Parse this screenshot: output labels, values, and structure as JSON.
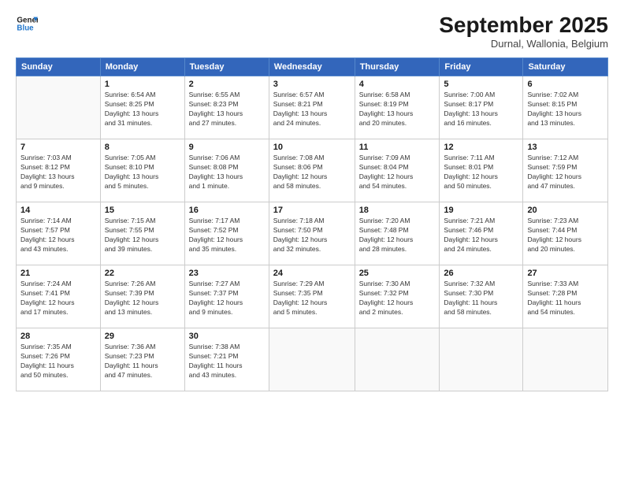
{
  "logo": {
    "line1": "General",
    "line2": "Blue"
  },
  "header": {
    "month_year": "September 2025",
    "location": "Durnal, Wallonia, Belgium"
  },
  "days_of_week": [
    "Sunday",
    "Monday",
    "Tuesday",
    "Wednesday",
    "Thursday",
    "Friday",
    "Saturday"
  ],
  "weeks": [
    [
      {
        "day": "",
        "info": ""
      },
      {
        "day": "1",
        "info": "Sunrise: 6:54 AM\nSunset: 8:25 PM\nDaylight: 13 hours\nand 31 minutes."
      },
      {
        "day": "2",
        "info": "Sunrise: 6:55 AM\nSunset: 8:23 PM\nDaylight: 13 hours\nand 27 minutes."
      },
      {
        "day": "3",
        "info": "Sunrise: 6:57 AM\nSunset: 8:21 PM\nDaylight: 13 hours\nand 24 minutes."
      },
      {
        "day": "4",
        "info": "Sunrise: 6:58 AM\nSunset: 8:19 PM\nDaylight: 13 hours\nand 20 minutes."
      },
      {
        "day": "5",
        "info": "Sunrise: 7:00 AM\nSunset: 8:17 PM\nDaylight: 13 hours\nand 16 minutes."
      },
      {
        "day": "6",
        "info": "Sunrise: 7:02 AM\nSunset: 8:15 PM\nDaylight: 13 hours\nand 13 minutes."
      }
    ],
    [
      {
        "day": "7",
        "info": "Sunrise: 7:03 AM\nSunset: 8:12 PM\nDaylight: 13 hours\nand 9 minutes."
      },
      {
        "day": "8",
        "info": "Sunrise: 7:05 AM\nSunset: 8:10 PM\nDaylight: 13 hours\nand 5 minutes."
      },
      {
        "day": "9",
        "info": "Sunrise: 7:06 AM\nSunset: 8:08 PM\nDaylight: 13 hours\nand 1 minute."
      },
      {
        "day": "10",
        "info": "Sunrise: 7:08 AM\nSunset: 8:06 PM\nDaylight: 12 hours\nand 58 minutes."
      },
      {
        "day": "11",
        "info": "Sunrise: 7:09 AM\nSunset: 8:04 PM\nDaylight: 12 hours\nand 54 minutes."
      },
      {
        "day": "12",
        "info": "Sunrise: 7:11 AM\nSunset: 8:01 PM\nDaylight: 12 hours\nand 50 minutes."
      },
      {
        "day": "13",
        "info": "Sunrise: 7:12 AM\nSunset: 7:59 PM\nDaylight: 12 hours\nand 47 minutes."
      }
    ],
    [
      {
        "day": "14",
        "info": "Sunrise: 7:14 AM\nSunset: 7:57 PM\nDaylight: 12 hours\nand 43 minutes."
      },
      {
        "day": "15",
        "info": "Sunrise: 7:15 AM\nSunset: 7:55 PM\nDaylight: 12 hours\nand 39 minutes."
      },
      {
        "day": "16",
        "info": "Sunrise: 7:17 AM\nSunset: 7:52 PM\nDaylight: 12 hours\nand 35 minutes."
      },
      {
        "day": "17",
        "info": "Sunrise: 7:18 AM\nSunset: 7:50 PM\nDaylight: 12 hours\nand 32 minutes."
      },
      {
        "day": "18",
        "info": "Sunrise: 7:20 AM\nSunset: 7:48 PM\nDaylight: 12 hours\nand 28 minutes."
      },
      {
        "day": "19",
        "info": "Sunrise: 7:21 AM\nSunset: 7:46 PM\nDaylight: 12 hours\nand 24 minutes."
      },
      {
        "day": "20",
        "info": "Sunrise: 7:23 AM\nSunset: 7:44 PM\nDaylight: 12 hours\nand 20 minutes."
      }
    ],
    [
      {
        "day": "21",
        "info": "Sunrise: 7:24 AM\nSunset: 7:41 PM\nDaylight: 12 hours\nand 17 minutes."
      },
      {
        "day": "22",
        "info": "Sunrise: 7:26 AM\nSunset: 7:39 PM\nDaylight: 12 hours\nand 13 minutes."
      },
      {
        "day": "23",
        "info": "Sunrise: 7:27 AM\nSunset: 7:37 PM\nDaylight: 12 hours\nand 9 minutes."
      },
      {
        "day": "24",
        "info": "Sunrise: 7:29 AM\nSunset: 7:35 PM\nDaylight: 12 hours\nand 5 minutes."
      },
      {
        "day": "25",
        "info": "Sunrise: 7:30 AM\nSunset: 7:32 PM\nDaylight: 12 hours\nand 2 minutes."
      },
      {
        "day": "26",
        "info": "Sunrise: 7:32 AM\nSunset: 7:30 PM\nDaylight: 11 hours\nand 58 minutes."
      },
      {
        "day": "27",
        "info": "Sunrise: 7:33 AM\nSunset: 7:28 PM\nDaylight: 11 hours\nand 54 minutes."
      }
    ],
    [
      {
        "day": "28",
        "info": "Sunrise: 7:35 AM\nSunset: 7:26 PM\nDaylight: 11 hours\nand 50 minutes."
      },
      {
        "day": "29",
        "info": "Sunrise: 7:36 AM\nSunset: 7:23 PM\nDaylight: 11 hours\nand 47 minutes."
      },
      {
        "day": "30",
        "info": "Sunrise: 7:38 AM\nSunset: 7:21 PM\nDaylight: 11 hours\nand 43 minutes."
      },
      {
        "day": "",
        "info": ""
      },
      {
        "day": "",
        "info": ""
      },
      {
        "day": "",
        "info": ""
      },
      {
        "day": "",
        "info": ""
      }
    ]
  ]
}
